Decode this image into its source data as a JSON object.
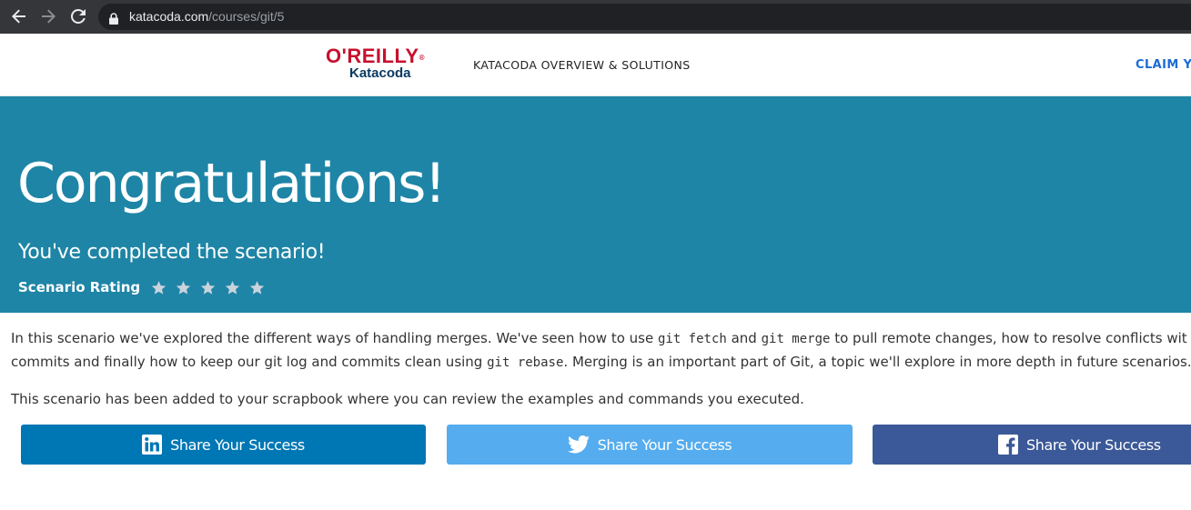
{
  "browser": {
    "url_host": "katacoda.com",
    "url_path": "/courses/git/5",
    "icons": [
      "back-arrow-icon",
      "forward-arrow-icon",
      "reload-icon",
      "lock-icon"
    ]
  },
  "header": {
    "logo_top": "O'REILLY",
    "logo_bottom": "Katacoda",
    "nav_link": "KATACODA OVERVIEW & SOLUTIONS",
    "claim_link": "CLAIM YO"
  },
  "hero": {
    "title": "Congratulations!",
    "subtitle": "You've completed the scenario!",
    "rating_label": "Scenario Rating",
    "rating_stars": 5
  },
  "content": {
    "p1_line1_a": "In this scenario we've explored the different ways of handling merges. We've seen how to use ",
    "p1_code1": "git fetch",
    "p1_line1_b": " and ",
    "p1_code2": "git merge",
    "p1_line1_c": " to pull remote changes, how to resolve conflicts wit",
    "p1_line2_a": "commits and finally how to keep our git log and commits clean using ",
    "p1_code3": "git rebase",
    "p1_line2_b": ". Merging is an important part of Git, a topic we'll explore in more depth in future scenarios.",
    "p2": "This scenario has been added to your scrapbook where you can review the examples and commands you executed."
  },
  "share": {
    "linkedin_label": "Share Your Success",
    "twitter_label": "Share Your Success",
    "facebook_label": "Share Your Success",
    "colors": {
      "linkedin": "#0077b5",
      "twitter": "#55acee",
      "facebook": "#3b5998"
    }
  },
  "colors": {
    "hero_bg": "#1e85a6",
    "brand_red": "#c8102e",
    "claim_link": "#1a6bd6"
  }
}
